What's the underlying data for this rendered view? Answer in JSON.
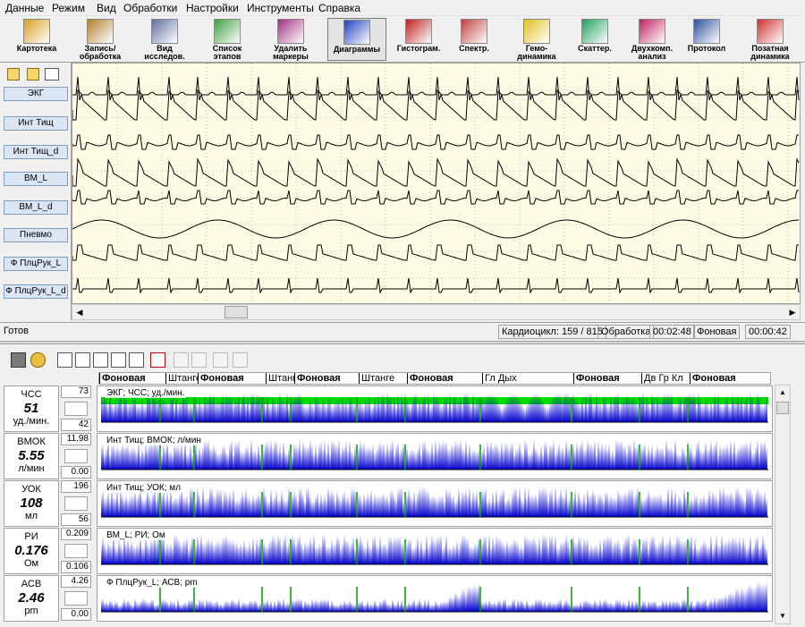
{
  "menu": [
    "Данные",
    "Режим",
    "Вид",
    "Обработки",
    "Настройки",
    "Инструменты",
    "Справка"
  ],
  "toolbar": [
    {
      "label": "Картотека",
      "icon": "cabinet-icon"
    },
    {
      "label": "Запись/\nобработка",
      "icon": "record-icon"
    },
    {
      "label": "Вид\nисследов.",
      "icon": "study-view-icon"
    },
    {
      "label": "Список\nэтапов",
      "icon": "stages-list-icon"
    },
    {
      "label": "Удалить\nмаркеры",
      "icon": "delete-markers-icon"
    },
    {
      "label": "Диаграммы",
      "icon": "diagrams-icon",
      "active": true
    },
    {
      "label": "Гистограм.",
      "icon": "histogram-icon"
    },
    {
      "label": "Спектр.",
      "icon": "spectrum-icon"
    },
    {
      "label": "Гемо-\nдинамика",
      "icon": "hemodynamics-icon"
    },
    {
      "label": "Скаттер.",
      "icon": "scatter-icon"
    },
    {
      "label": "Двухкомп.\nанализ",
      "icon": "two-component-icon"
    },
    {
      "label": "Протокол",
      "icon": "protocol-icon"
    },
    {
      "label": "Позатная\nдинамика",
      "icon": "dynamics-icon"
    }
  ],
  "channels": [
    "ЭКГ",
    "Инт Тищ",
    "Инт Тищ_d",
    "ВМ_L",
    "ВМ_L_d",
    "Пневмо",
    "Ф ПлцРук_L",
    "Ф ПлцРук_L_d"
  ],
  "status": {
    "ready": "Готов",
    "cardio": "Кардиоцикл: 159 / 815",
    "mode": "Обработка",
    "time1": "00:02:48",
    "stage": "Фоновая",
    "time2": "00:00:42"
  },
  "segments": [
    "Фоновая",
    "Штанге",
    "Фоновая",
    "Штанг",
    "Фоновая",
    "Штанге",
    "Фоновая",
    "Гл Дых",
    "Фоновая",
    "Дв Гр Кл",
    "Фоновая"
  ],
  "trends": [
    {
      "name": "ЧСС",
      "value": "51",
      "unit": "уд./мин.",
      "max": "73",
      "min": "42",
      "title": "ЭКГ; ЧСС; уд./мин."
    },
    {
      "name": "ВМОК",
      "value": "5.55",
      "unit": "л/мин",
      "max": "11.98",
      "min": "0.00",
      "title": "Инт Тищ; ВМОК; л/мин"
    },
    {
      "name": "УОК",
      "value": "108",
      "unit": "мл",
      "max": "196",
      "min": "56",
      "title": "Инт Тищ; УОК; мл"
    },
    {
      "name": "РИ",
      "value": "0.176",
      "unit": "Ом",
      "max": "0.209",
      "min": "0.106",
      "title": "ВМ_L; РИ; Ом"
    },
    {
      "name": "АСВ",
      "value": "2.46",
      "unit": "pm",
      "max": "4.26",
      "min": "0.00",
      "title": "Ф ПлцРук_L; АСВ; pm"
    }
  ],
  "colors": {
    "trace": "#000000",
    "plot_bg": "#fdfbe3",
    "trend_fill": "#0000cc",
    "trend_band": "#00dd00",
    "marker": "#009900"
  }
}
